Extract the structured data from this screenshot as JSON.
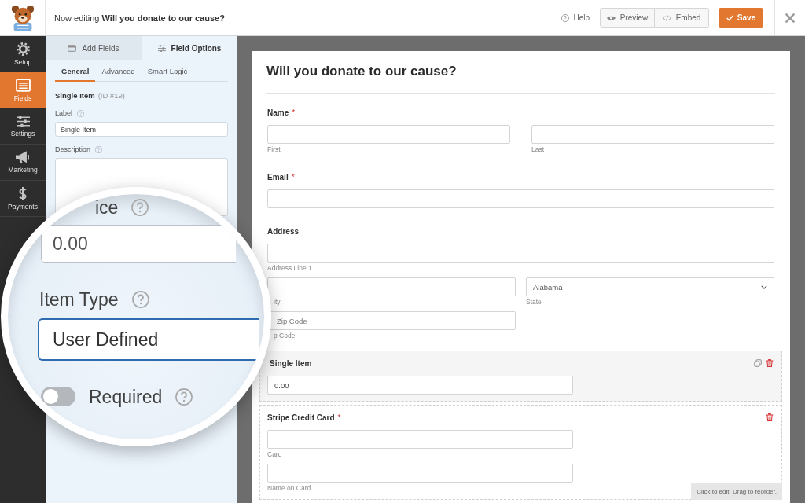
{
  "header": {
    "title": "Now editing **Will you donate to our cause?**",
    "help": "Help",
    "buttons": [
      {
        "kind": "preview",
        "label": "Preview"
      },
      {
        "kind": "embed",
        "label": "Embed"
      }
    ],
    "save": "Save"
  },
  "sidebar": {
    "items": [
      {
        "kind": "setup",
        "label": "Setup",
        "selected": false
      },
      {
        "kind": "fields",
        "label": "Fields",
        "selected": true
      },
      {
        "kind": "settings",
        "label": "Settings",
        "selected": false
      },
      {
        "kind": "marketing",
        "label": "Marketing",
        "selected": false
      },
      {
        "kind": "payments",
        "label": "Payments",
        "selected": false
      }
    ]
  },
  "panel": {
    "tabs": [
      {
        "kind": "add",
        "label": "Add Fields",
        "selected": false
      },
      {
        "kind": "options",
        "label": "Field Options",
        "selected": true
      }
    ],
    "subtabs": [
      {
        "label": "General",
        "selected": true
      },
      {
        "label": "Advanced",
        "selected": false
      },
      {
        "label": "Smart Logic",
        "selected": false
      }
    ],
    "heading": "Single Item",
    "id": "(ID #19)",
    "options": [
      {
        "kind": "text",
        "label": "Label",
        "value": "Single Item"
      },
      {
        "kind": "textarea",
        "label": "Description"
      }
    ]
  },
  "magnifier": {
    "options": [
      {
        "kind": "text",
        "label": "ice",
        "value": "0.00"
      },
      {
        "kind": "select",
        "label": "Item Type",
        "value": "User Defined"
      },
      {
        "kind": "toggle",
        "label": "Required",
        "on": false
      }
    ]
  },
  "form": {
    "title": "Will you donate to our cause?",
    "fields": [
      {
        "kind": "name",
        "label": "Name",
        "required_mark": "*",
        "selected": false,
        "hovered": false,
        "inputs": [
          {
            "kind": "text",
            "sublabel": "First"
          },
          {
            "kind": "text",
            "sublabel": "Last"
          }
        ]
      },
      {
        "kind": "email",
        "label": "Email",
        "required_mark": "*",
        "selected": false,
        "hovered": false,
        "inputs": [
          {
            "kind": "text"
          }
        ]
      },
      {
        "kind": "address",
        "label": "Address",
        "selected": false,
        "hovered": false,
        "inputs": [
          {
            "kind": "text",
            "sublabel": "Address Line 1"
          },
          {
            "kind": "text",
            "sublabel": "ity"
          },
          {
            "kind": "select",
            "value": "Alabama",
            "sublabel": "State"
          },
          {
            "kind": "text",
            "placeholder": "Zip Code",
            "sublabel": "p Code"
          }
        ]
      },
      {
        "kind": "single",
        "label": "Single Item",
        "selected": true,
        "hovered": false,
        "inputs": [
          {
            "kind": "text",
            "value": "0.00"
          }
        ]
      },
      {
        "kind": "card",
        "label": "Stripe Credit Card",
        "required_mark": "*",
        "selected": false,
        "hovered": true,
        "inputs": [
          {
            "kind": "text",
            "sublabel": "Card"
          },
          {
            "kind": "text",
            "sublabel": "Name on Card"
          }
        ],
        "hint": "Click to edit. Drag to reorder."
      }
    ]
  }
}
